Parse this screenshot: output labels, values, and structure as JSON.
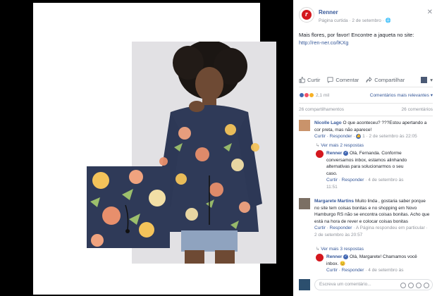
{
  "post": {
    "page_name": "Renner",
    "meta": "Página curtida · 2 de setembro · 🌐",
    "text": "Mais flores, por favor! Encontre a jaqueta no site:",
    "link": "http://ren-ner.co/lKXg",
    "close_icon": "close-icon"
  },
  "actions": {
    "like": "Curtir",
    "comment": "Comentar",
    "share": "Compartilhar"
  },
  "reactions": {
    "count": "2,1 mil",
    "sort": "Comentários mais relevantes ▾",
    "colors": [
      "#4267b2",
      "#f25268",
      "#f7b125"
    ]
  },
  "stats": {
    "shares": "26 compartilhamentos",
    "comments": "26 comentários"
  },
  "comments": [
    {
      "author": "Nicolle Lago",
      "text": "O que aconteceu? ???Estou apertando a cor preta, mas não aparece!",
      "meta_links": "Curtir · Responder · ",
      "meta_tail": "1 · 2 de setembro às 22:05",
      "replies_link": "Ver mais 2 respostas",
      "reply": {
        "author": "Renner",
        "text": "Olá, Fernanda. Conforme conversamos inbox, estamos alinhando alternativas para solucionarmos o seu caso.",
        "meta_links": "Curtir · Responder",
        "meta_tail": " · 4 de setembro às 11:51"
      }
    },
    {
      "author": "Margarete Martins",
      "text": "Muito linda , gostaria saber porque no site tem coisas bonitas e no shopping em Novo Hamburgo RS não se encontra coisas bonitas. Acho que está na hora de rever e colocar coisas bonitas",
      "meta_links": "Curtir · Responder",
      "meta_tail": " · A Página respondeu em particular · 2 de setembro às 20:57",
      "replies_link": "Ver mais 3 respostas",
      "reply": {
        "author": "Renner",
        "text": "Olá, Margarete! Chamamos você inbox. 😊",
        "meta_links": "Curtir · Responder",
        "meta_tail": " · 4 de setembro às"
      }
    }
  ],
  "composer": {
    "placeholder": "Escreva um comentário..."
  }
}
